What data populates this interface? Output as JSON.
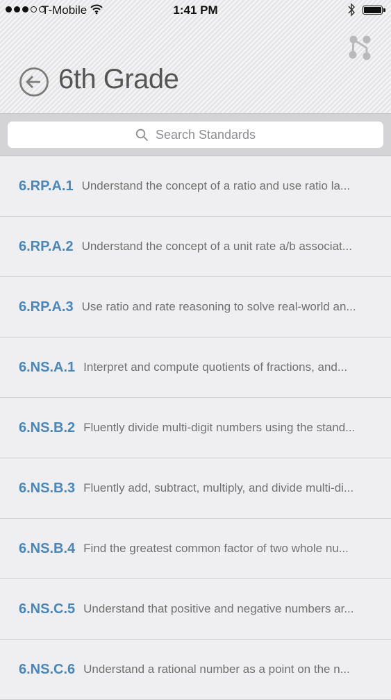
{
  "status_bar": {
    "carrier": "T-Mobile",
    "time": "1:41 PM",
    "signal_bars_filled": 3,
    "signal_bars_total": 5,
    "battery_level": 1.0
  },
  "header": {
    "title": "6th Grade",
    "back_icon": "back-arrow-circle-icon",
    "share_icon": "share-icon"
  },
  "search": {
    "placeholder": "Search Standards",
    "icon": "search-icon"
  },
  "colors": {
    "code_blue": "#4a86b8",
    "description_gray": "#707070",
    "list_background": "#efeff1"
  },
  "standards": [
    {
      "code": "6.RP.A.1",
      "description": "Understand the concept of a ratio and use ratio la..."
    },
    {
      "code": "6.RP.A.2",
      "description": "Understand the concept of a unit rate a/b associat..."
    },
    {
      "code": "6.RP.A.3",
      "description": "Use ratio and rate reasoning to solve real-world an..."
    },
    {
      "code": "6.NS.A.1",
      "description": "Interpret and compute quotients of fractions, and..."
    },
    {
      "code": "6.NS.B.2",
      "description": "Fluently divide multi-digit numbers using the stand..."
    },
    {
      "code": "6.NS.B.3",
      "description": "Fluently add, subtract, multiply, and divide multi-di..."
    },
    {
      "code": "6.NS.B.4",
      "description": "Find the greatest common factor of two whole nu..."
    },
    {
      "code": "6.NS.C.5",
      "description": "Understand that positive and negative numbers ar..."
    },
    {
      "code": "6.NS.C.6",
      "description": "Understand a rational number as a point on the n..."
    }
  ]
}
